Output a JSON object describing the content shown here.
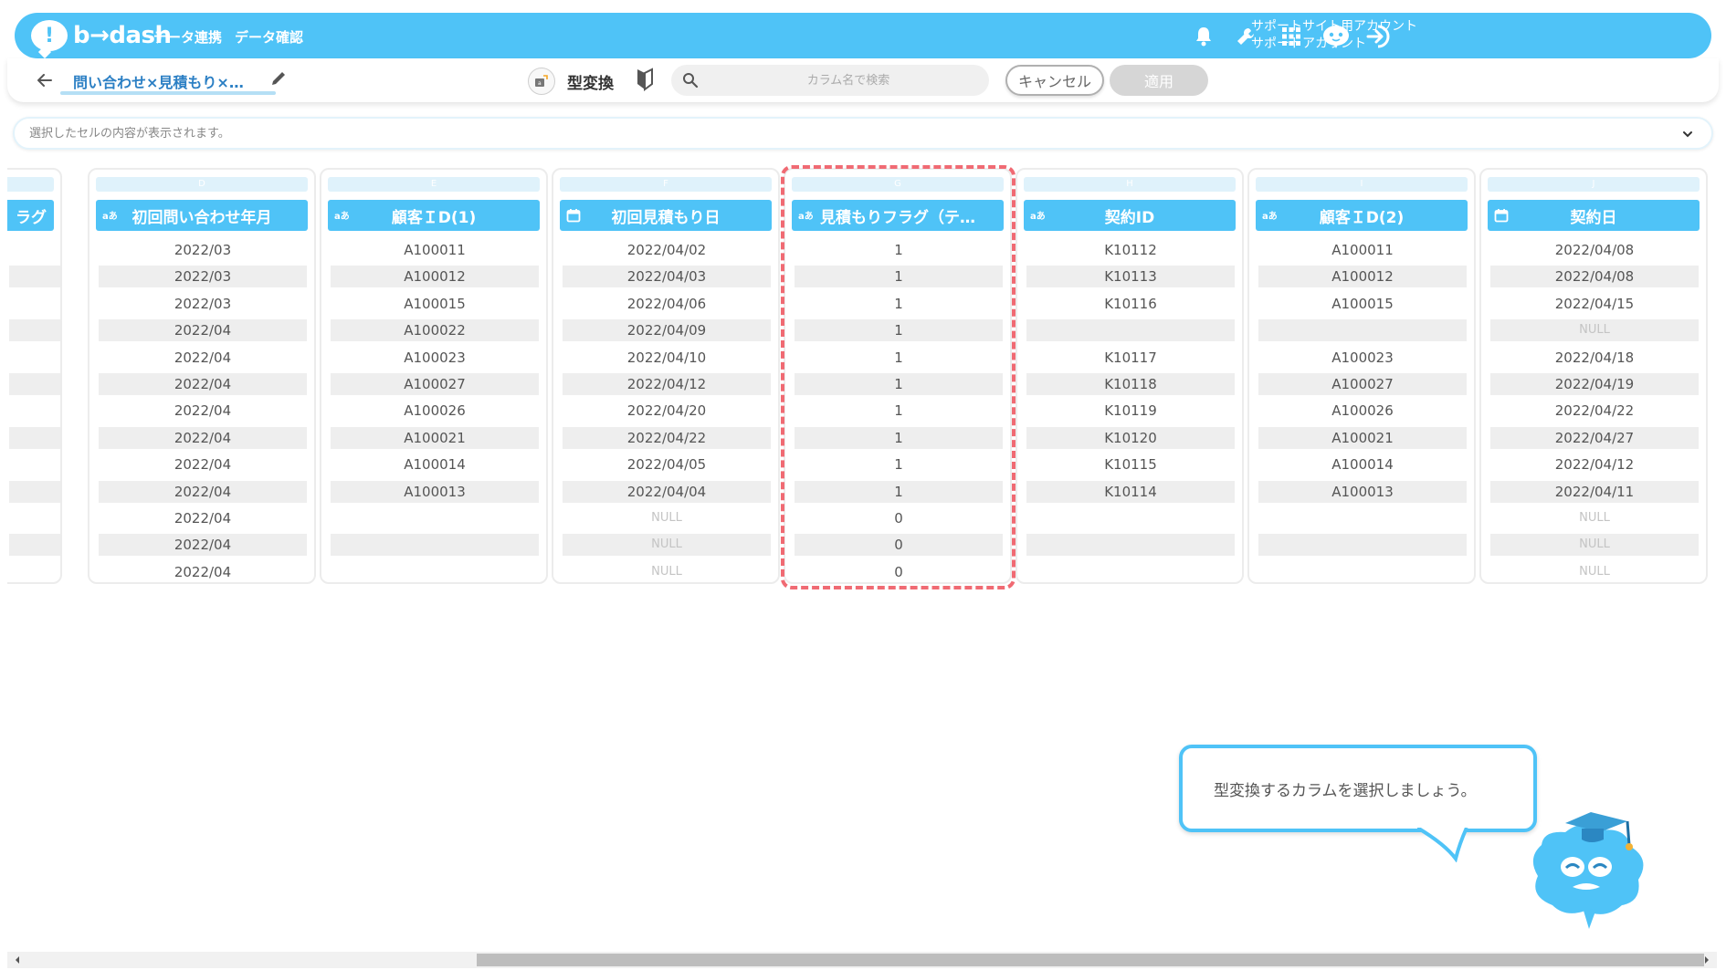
{
  "header": {
    "logo_text": "b→dash",
    "nav": [
      "データ連携",
      "データ確認"
    ],
    "account_line1": "サポートサイト用アカウント",
    "account_line2": "サポートアカウント",
    "icons": [
      "bell-icon",
      "wrench-icon",
      "grid-icon",
      "chat-mascot-icon",
      "logout-icon"
    ],
    "accent_color": "#4fc3f7"
  },
  "toolbar": {
    "title": "問い合わせ×見積もり×…",
    "mode_label": "型変換",
    "search_placeholder": "カラム名で検索",
    "cancel_label": "キャンセル",
    "apply_label": "適用"
  },
  "cell_bar": {
    "placeholder": "選択したセルの内容が表示されます。"
  },
  "grid": {
    "highlight_color": "#f06a73",
    "columns": [
      {
        "letter": "",
        "header": "ラグ",
        "type": "",
        "cells": [],
        "partial": true
      },
      {
        "letter": "D",
        "header": "初回問い合わせ年月",
        "type": "text",
        "cells": [
          "2022/03",
          "2022/03",
          "2022/03",
          "2022/04",
          "2022/04",
          "2022/04",
          "2022/04",
          "2022/04",
          "2022/04",
          "2022/04",
          "2022/04",
          "2022/04",
          "2022/04"
        ]
      },
      {
        "letter": "E",
        "header": "顧客ＩD(1)",
        "type": "text",
        "cells": [
          "A100011",
          "A100012",
          "A100015",
          "A100022",
          "A100023",
          "A100027",
          "A100026",
          "A100021",
          "A100014",
          "A100013",
          "",
          "",
          ""
        ]
      },
      {
        "letter": "F",
        "header": "初回見積もり日",
        "type": "date",
        "cells": [
          "2022/04/02",
          "2022/04/03",
          "2022/04/06",
          "2022/04/09",
          "2022/04/10",
          "2022/04/12",
          "2022/04/20",
          "2022/04/22",
          "2022/04/05",
          "2022/04/04",
          "NULL",
          "NULL",
          "NULL"
        ]
      },
      {
        "letter": "G",
        "header": "見積もりフラグ（テ…",
        "type": "text",
        "cells": [
          "1",
          "1",
          "1",
          "1",
          "1",
          "1",
          "1",
          "1",
          "1",
          "1",
          "0",
          "0",
          "0"
        ]
      },
      {
        "letter": "H",
        "header": "契約ID",
        "type": "text",
        "cells": [
          "K10112",
          "K10113",
          "K10116",
          "",
          "K10117",
          "K10118",
          "K10119",
          "K10120",
          "K10115",
          "K10114",
          "",
          "",
          ""
        ]
      },
      {
        "letter": "I",
        "header": "顧客ＩD(2)",
        "type": "text",
        "cells": [
          "A100011",
          "A100012",
          "A100015",
          "",
          "A100023",
          "A100027",
          "A100026",
          "A100021",
          "A100014",
          "A100013",
          "",
          "",
          ""
        ]
      },
      {
        "letter": "J",
        "header": "契約日",
        "type": "date",
        "cells": [
          "2022/04/08",
          "2022/04/08",
          "2022/04/15",
          "NULL",
          "2022/04/18",
          "2022/04/19",
          "2022/04/22",
          "2022/04/27",
          "2022/04/12",
          "2022/04/11",
          "NULL",
          "NULL",
          "NULL"
        ]
      }
    ]
  },
  "tooltip": {
    "text": "型変換するカラムを選択しましょう。"
  }
}
